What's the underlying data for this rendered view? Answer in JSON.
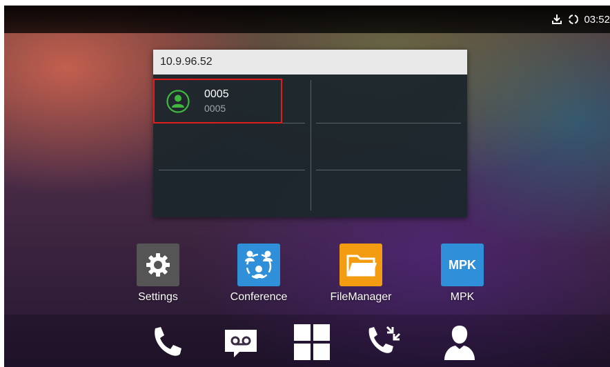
{
  "status_bar": {
    "icons": [
      "download-icon",
      "sync-icon"
    ],
    "time": "03:52"
  },
  "widget": {
    "header": "10.9.96.52",
    "contact": {
      "name": "0005",
      "number": "0005",
      "icon": "contact-avatar-icon",
      "icon_color": "#3fb83f",
      "highlight_color": "#e21b1b"
    }
  },
  "apps": [
    {
      "label": "Settings",
      "icon": "gear-icon",
      "color": "#555555"
    },
    {
      "label": "Conference",
      "icon": "conference-icon",
      "color": "#2f8fd8"
    },
    {
      "label": "FileManager",
      "icon": "folder-icon",
      "color": "#f39c12"
    },
    {
      "label": "MPK",
      "icon": "mpk-icon",
      "icon_text": "MPK",
      "color": "#2f8fd8"
    }
  ],
  "dock": [
    "phone-icon",
    "voicemail-icon",
    "apps-grid-icon",
    "call-transfer-icon",
    "contacts-icon"
  ]
}
